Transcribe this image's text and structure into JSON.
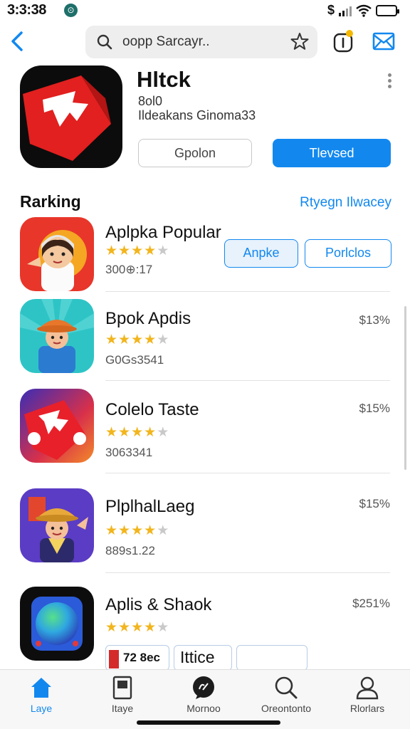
{
  "status_bar": {
    "time": "3:3:38",
    "left_badge": "⊙",
    "carrier_glyph": "$",
    "battery_level": 0.7,
    "colors": {
      "badge": "#1f6f6a",
      "battery": "#f3e23a"
    }
  },
  "nav": {
    "search_text": "oopp Sarcayr..",
    "accent": "#1288ef"
  },
  "app": {
    "title": "Hltck",
    "line1": "8ol0",
    "line2": "Ildeakans Ginoma33",
    "secondary_button": "Gpolon",
    "primary_button": "Tlevsed"
  },
  "section": {
    "title": "Rarking",
    "link": "Rtyegn Ilwacey"
  },
  "apps": [
    {
      "name": "Aplpka Popular",
      "rating": 3.5,
      "meta": "300⊕:17",
      "buttons": [
        "Anpke",
        "Porlclos"
      ],
      "price": ""
    },
    {
      "name": "Bpok Apdis",
      "rating": 3.5,
      "meta": "G0Gs3541",
      "price": "$13%"
    },
    {
      "name": "Colelo Taste",
      "rating": 3.5,
      "meta": "3063341",
      "price": "$15%"
    },
    {
      "name": "PlplhalLaeg",
      "rating": 3.5,
      "meta": "889s1.22",
      "price": "$15%"
    },
    {
      "name": "Aplis & Shaok",
      "rating": 4,
      "meta": "",
      "price": "$251%"
    }
  ],
  "peek": {
    "chip1": "72 8ec",
    "chip2": "Ittice"
  },
  "tabs": [
    {
      "label": "Laye",
      "icon": "home-icon",
      "active": true
    },
    {
      "label": "Itaye",
      "icon": "bookmark-icon",
      "active": false
    },
    {
      "label": "Mornoo",
      "icon": "chat-icon",
      "active": false
    },
    {
      "label": "Oreontonto",
      "icon": "search-icon",
      "active": false
    },
    {
      "label": "Rlorlars",
      "icon": "person-icon",
      "active": false
    }
  ]
}
